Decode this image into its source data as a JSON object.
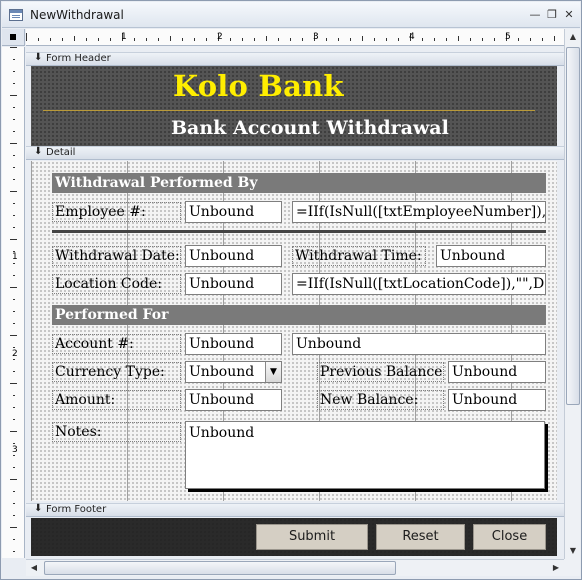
{
  "window": {
    "title": "NewWithdrawal",
    "minimize_icon": "minimize-icon",
    "restore_icon": "restore-icon",
    "close_icon": "close-icon"
  },
  "rulers": {
    "horizontal": [
      "1",
      "2",
      "3",
      "4",
      "5"
    ],
    "vertical": [
      "1",
      "2",
      "3"
    ]
  },
  "sections": {
    "header": "Form Header",
    "detail": "Detail",
    "footer": "Form Footer"
  },
  "header": {
    "brand": "Kolo Bank",
    "subtitle": "Bank Account Withdrawal"
  },
  "performed_by": {
    "title": "Withdrawal Performed By",
    "employee_label": "Employee #:",
    "employee_value": "Unbound",
    "employee_expression": "=IIf(IsNull([txtEmployeeNumber]),\"",
    "date_label": "Withdrawal Date:",
    "date_value": "Unbound",
    "time_label": "Withdrawal Time:",
    "time_value": "Unbound",
    "location_label": "Location Code:",
    "location_value": "Unbound",
    "location_expression": "=IIf(IsNull([txtLocationCode]),\"\",DI"
  },
  "performed_for": {
    "title": "Performed For",
    "account_label": "Account #:",
    "account_value": "Unbound",
    "account_name_value": "Unbound",
    "currency_label": "Currency Type:",
    "currency_value": "Unbound",
    "prev_balance_label": "Previous Balance:",
    "prev_balance_value": "Unbound",
    "amount_label": "Amount:",
    "amount_value": "Unbound",
    "new_balance_label": "New Balance:",
    "new_balance_value": "Unbound",
    "notes_label": "Notes:",
    "notes_value": "Unbound"
  },
  "footer": {
    "submit": "Submit",
    "reset": "Reset",
    "close": "Close"
  },
  "colors": {
    "brand_yellow": "#ffee00",
    "banner_gray": "#7a7a7a",
    "header_dark": "#545454",
    "button_face": "#d5cfc4"
  }
}
